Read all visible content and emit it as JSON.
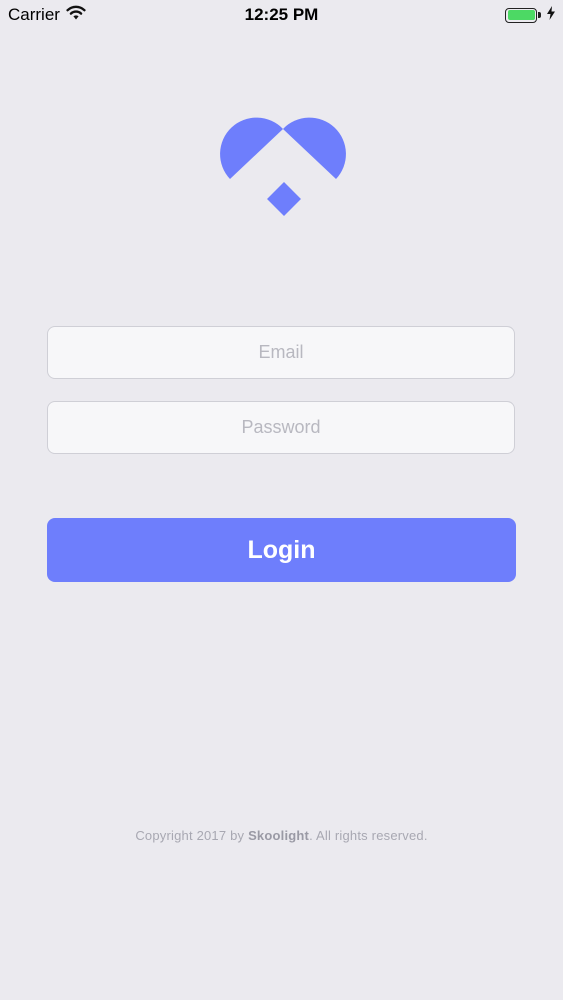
{
  "colors": {
    "accent": "#6e7efc",
    "background": "#ebeaef",
    "battery": "#4cd964"
  },
  "status_bar": {
    "carrier": "Carrier",
    "time": "12:25 PM",
    "icons": [
      "wifi-icon",
      "battery-icon",
      "charging-icon"
    ]
  },
  "logo": {
    "icon": "heart-logo-icon"
  },
  "login_form": {
    "email": {
      "value": "",
      "placeholder": "Email"
    },
    "password": {
      "value": "",
      "placeholder": "Password"
    },
    "login_label": "Login"
  },
  "footer": {
    "copyright_prefix": "Copyright 2017 by ",
    "brand": "Skoolight",
    "copyright_suffix": ". All rights reserved."
  }
}
